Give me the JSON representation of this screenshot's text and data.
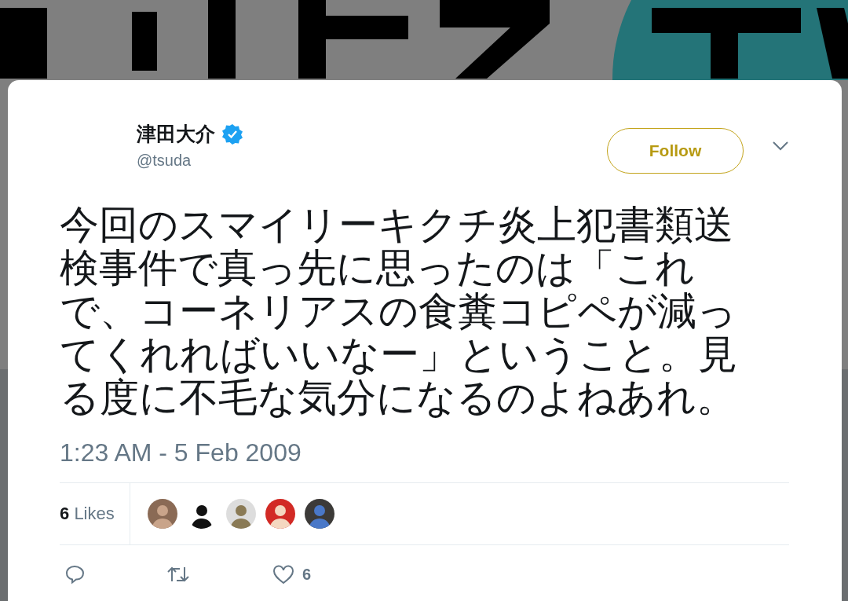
{
  "tweet": {
    "author": {
      "name": "津田大介",
      "verified": true,
      "handle": "@tsuda"
    },
    "follow_button": "Follow",
    "text": "今回のスマイリーキクチ炎上犯書類送検事件で真っ先に思ったのは「これで、コーネリアスの食糞コピペが減ってくれればいいなー」ということ。見る度に不毛な気分になるのよねあれ。",
    "timestamp": "1:23 AM - 5 Feb 2009",
    "likes": {
      "count": "6",
      "label": "Likes"
    },
    "actions": [
      {
        "kind": "reply"
      },
      {
        "kind": "retweet"
      },
      {
        "kind": "like",
        "count": "6"
      }
    ]
  }
}
